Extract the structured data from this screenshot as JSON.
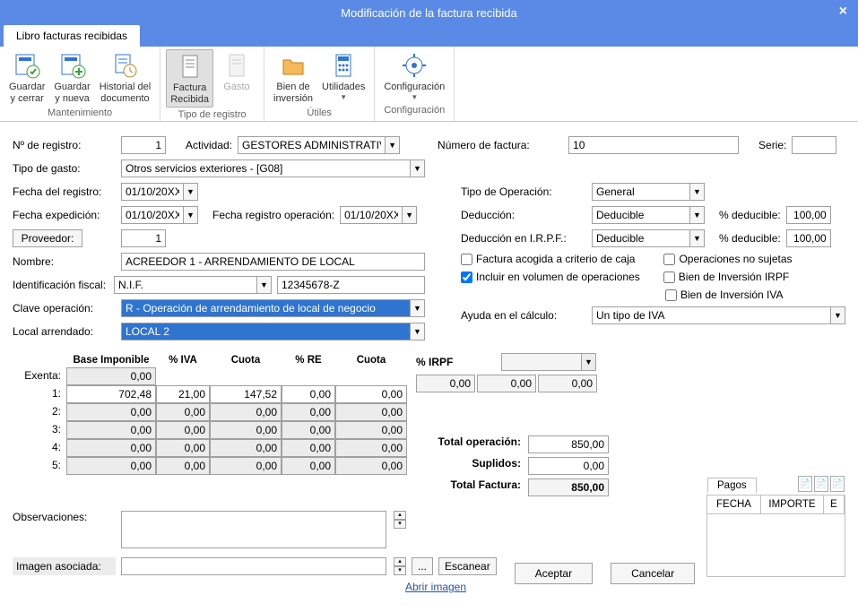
{
  "window": {
    "title": "Modificación de la factura recibida"
  },
  "tabs": {
    "main": "Libro facturas recibidas"
  },
  "ribbon": {
    "groups": [
      {
        "label": "Mantenimiento",
        "items": [
          "Guardar\ny cerrar",
          "Guardar\ny nueva",
          "Historial del\ndocumento"
        ]
      },
      {
        "label": "Tipo de registro",
        "items": [
          "Factura\nRecibida",
          "Gasto"
        ]
      },
      {
        "label": "Útiles",
        "items": [
          "Bien de\ninversión",
          "Utilidades"
        ]
      },
      {
        "label": "Configuración",
        "items": [
          "Configuración"
        ]
      }
    ]
  },
  "form": {
    "n_registro_lbl": "Nº de registro:",
    "n_registro": "1",
    "actividad_lbl": "Actividad:",
    "actividad": "GESTORES ADMINISTRATIVOS",
    "numero_factura_lbl": "Número de factura:",
    "numero_factura": "10",
    "serie_lbl": "Serie:",
    "serie": "",
    "tipo_gasto_lbl": "Tipo de gasto:",
    "tipo_gasto": "Otros servicios exteriores - [G08]",
    "fecha_registro_lbl": "Fecha del registro:",
    "fecha_registro": "01/10/20XX",
    "fecha_expedicion_lbl": "Fecha expedición:",
    "fecha_expedicion": "01/10/20XX",
    "fecha_reg_op_lbl": "Fecha registro operación:",
    "fecha_reg_op": "01/10/20XX",
    "proveedor_btn": "Proveedor:",
    "proveedor": "1",
    "nombre_lbl": "Nombre:",
    "nombre": "ACREEDOR 1 - ARRENDAMIENTO DE LOCAL",
    "id_fiscal_lbl": "Identificación fiscal:",
    "id_fiscal_tipo": "N.I.F.",
    "id_fiscal_num": "12345678-Z",
    "clave_op_lbl": "Clave operación:",
    "clave_op": "R - Operación de arrendamiento de local de negocio",
    "local_arr_lbl": "Local arrendado:",
    "local_arr": "LOCAL 2",
    "tipo_op_lbl": "Tipo de Operación:",
    "tipo_op": "General",
    "deduccion_lbl": "Deducción:",
    "deduccion": "Deducible",
    "pct_ded_lbl": "% deducible:",
    "pct_ded": "100,00",
    "ded_irpf_lbl": "Deducción en I.R.P.F.:",
    "ded_irpf": "Deducible",
    "pct_ded_irpf": "100,00",
    "chk_caja": "Factura acogida a criterio de caja",
    "chk_no_sujetas": "Operaciones no sujetas",
    "chk_volumen": "Incluir en  volumen de operaciones",
    "chk_bien_irpf": "Bien de Inversión IRPF",
    "chk_bien_iva": "Bien de Inversión IVA",
    "ayuda_lbl": "Ayuda en el cálculo:",
    "ayuda": "Un tipo de IVA"
  },
  "table": {
    "headers": {
      "base": "Base Imponible",
      "iva": "% IVA",
      "cuota": "Cuota",
      "re": "% RE",
      "cuota2": "Cuota"
    },
    "rows": [
      {
        "label": "Exenta:",
        "base": "0,00",
        "iva": "",
        "cuota": "",
        "re": "",
        "cuota2": "",
        "gray": true
      },
      {
        "label": "1:",
        "base": "702,48",
        "iva": "21,00",
        "cuota": "147,52",
        "re": "0,00",
        "cuota2": "0,00"
      },
      {
        "label": "2:",
        "base": "0,00",
        "iva": "0,00",
        "cuota": "0,00",
        "re": "0,00",
        "cuota2": "0,00",
        "gray": true
      },
      {
        "label": "3:",
        "base": "0,00",
        "iva": "0,00",
        "cuota": "0,00",
        "re": "0,00",
        "cuota2": "0,00",
        "gray": true
      },
      {
        "label": "4:",
        "base": "0,00",
        "iva": "0,00",
        "cuota": "0,00",
        "re": "0,00",
        "cuota2": "0,00",
        "gray": true
      },
      {
        "label": "5:",
        "base": "0,00",
        "iva": "0,00",
        "cuota": "0,00",
        "re": "0,00",
        "cuota2": "0,00",
        "gray": true
      }
    ],
    "irpf_hdr": "% IRPF",
    "irpf_blank": "",
    "irpf_vals": [
      "0,00",
      "0,00",
      "0,00"
    ]
  },
  "totals": {
    "op_lbl": "Total operación:",
    "op": "850,00",
    "sup_lbl": "Suplidos:",
    "sup": "0,00",
    "fac_lbl": "Total Factura:",
    "fac": "850,00"
  },
  "obs": {
    "lbl": "Observaciones:",
    "val": ""
  },
  "img": {
    "lbl": "Imagen asociada:",
    "val": "",
    "browse": "...",
    "scan": "Escanear",
    "open": "Abrir imagen"
  },
  "pagos": {
    "title": "Pagos",
    "cols": [
      "FECHA",
      "IMPORTE",
      "E"
    ]
  },
  "buttons": {
    "ok": "Aceptar",
    "cancel": "Cancelar"
  }
}
